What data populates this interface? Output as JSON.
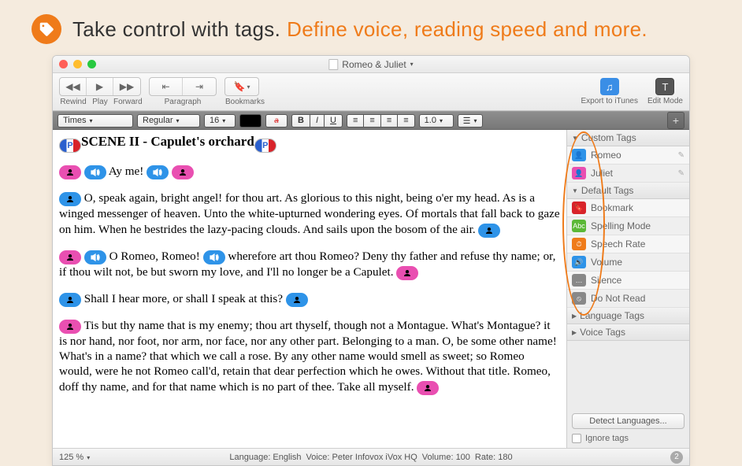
{
  "banner": {
    "black": "Take control with tags.",
    "orange": "Define voice, reading speed and more."
  },
  "window_title": "Romeo & Juliet",
  "toolbar": {
    "rewind": "Rewind",
    "play": "Play",
    "forward": "Forward",
    "paragraph": "Paragraph",
    "bookmarks": "Bookmarks",
    "export": "Export to iTunes",
    "editmode": "Edit Mode"
  },
  "format": {
    "font": "Times",
    "weight": "Regular",
    "size": "16",
    "lineheight": "1.0"
  },
  "doc": {
    "scene": "SCENE II - Capulet's orchard",
    "l1": " Ay me! ",
    "p2": " O, speak again, bright angel! for thou art. As glorious to this night, being o'er my head. As is a winged messenger of heaven. Unto the white-upturned wondering eyes. Of mortals that fall back to gaze on him. When he bestrides the lazy-pacing clouds. And sails upon the bosom of the air. ",
    "p3a": " O Romeo, Romeo! ",
    "p3b": "  wherefore art thou Romeo? Deny thy father and refuse thy name; or, if thou wilt not, be but sworn my love, and I'll no longer be a Capulet. ",
    "p4": " Shall I hear more, or shall I speak at this? ",
    "p5": " Tis but thy name that is my enemy; thou art thyself, though not a Montague. What's Montague? it is nor hand, nor foot, nor arm, nor face, nor any other part. Belonging to a man. O, be some other name! What's in a name? that which we call a rose. By any other name would smell as sweet; so Romeo would, were he not Romeo call'd, retain that dear perfection which he owes. Without that title. Romeo, doff thy name, and for that name which is no part of thee. Take all myself. "
  },
  "sidebar": {
    "custom": "Custom Tags",
    "default": "Default Tags",
    "lang": "Language Tags",
    "voice": "Voice Tags",
    "romeo": "Romeo",
    "juliet": "Juliet",
    "bookmark": "Bookmark",
    "spelling": "Spelling Mode",
    "rate": "Speech Rate",
    "volume": "Volume",
    "silence": "Silence",
    "donotread": "Do Not Read",
    "detect": "Detect Languages...",
    "ignore": "Ignore tags"
  },
  "status": {
    "zoom": "125 %",
    "language": "Language: English",
    "voice": "Voice: Peter Infovox iVox HQ",
    "volume": "Volume: 100",
    "rate": "Rate: 180",
    "badge": "2"
  }
}
